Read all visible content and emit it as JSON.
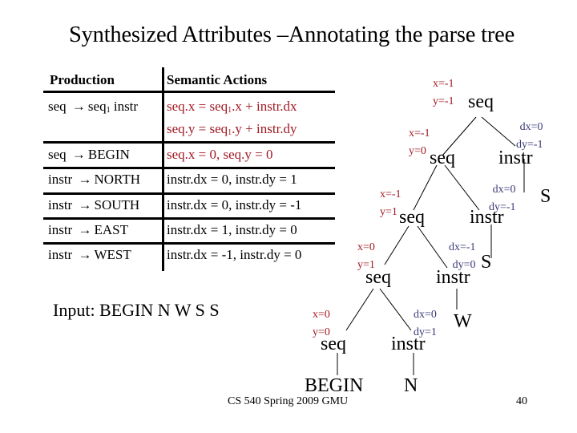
{
  "slide": {
    "title": "Synthesized Attributes –Annotating the parse tree",
    "footer": "CS 540 Spring 2009 GMU",
    "page_number": "40"
  },
  "table": {
    "headers": {
      "production": "Production",
      "actions": "Semantic Actions"
    },
    "rows": [
      {
        "lhs": "seq",
        "arrow": "→",
        "rhs": "seq",
        "rhs_sub": "1",
        "rhs_rest": " instr",
        "actions": [
          {
            "a": "seq.x = seq",
            "sub": "1",
            "b": ".x + instr.dx"
          },
          {
            "a": "seq.y = seq",
            "sub": "1",
            "b": ".y + instr.dy"
          }
        ],
        "action_color": "red"
      },
      {
        "lhs": "seq",
        "arrow": "→",
        "rhs": "BEGIN",
        "actions": [
          "seq.x = 0,  seq.y = 0"
        ],
        "action_color": "red"
      },
      {
        "lhs": "instr",
        "arrow": "→",
        "rhs": "NORTH",
        "actions": [
          "instr.dx = 0, instr.dy = 1"
        ],
        "action_color": "black"
      },
      {
        "lhs": "instr",
        "arrow": "→",
        "rhs": "SOUTH",
        "actions": [
          "instr.dx = 0, instr.dy = -1"
        ],
        "action_color": "black"
      },
      {
        "lhs": "instr",
        "arrow": "→",
        "rhs": "EAST",
        "actions": [
          "instr.dx = 1, instr.dy = 0"
        ],
        "action_color": "black"
      },
      {
        "lhs": "instr",
        "arrow": "→",
        "rhs": "WEST",
        "actions": [
          "instr.dx = -1, instr.dy = 0"
        ],
        "action_color": "black"
      }
    ]
  },
  "input": "Input:  BEGIN N W S S",
  "tree": {
    "nodes": [
      {
        "id": "seq1",
        "label": "seq",
        "attrs": [
          "x=-1",
          "y=-1"
        ],
        "attr_kind": "inherited-xy"
      },
      {
        "id": "seq2",
        "label": "seq",
        "attrs": [
          "x=-1",
          "y=0"
        ],
        "attr_kind": "inherited-xy"
      },
      {
        "id": "instr1",
        "label": "instr",
        "attrs": [
          "dx=0",
          "dy=-1"
        ],
        "attr_kind": "delta"
      },
      {
        "id": "leafS1",
        "label": "S"
      },
      {
        "id": "seq3",
        "label": "seq",
        "attrs": [
          "x=-1",
          "y=1"
        ],
        "attr_kind": "inherited-xy"
      },
      {
        "id": "instr2",
        "label": "instr",
        "attrs": [
          "dx=0",
          "dy=-1"
        ],
        "attr_kind": "delta"
      },
      {
        "id": "leafS2",
        "label": "S"
      },
      {
        "id": "seq4",
        "label": "seq",
        "attrs": [
          "x=0",
          "y=1"
        ],
        "attr_kind": "inherited-xy"
      },
      {
        "id": "instr3",
        "label": "instr",
        "attrs": [
          "dx=-1",
          "dy=0"
        ],
        "attr_kind": "delta"
      },
      {
        "id": "leafW",
        "label": "W"
      },
      {
        "id": "seq5",
        "label": "seq",
        "attrs": [
          "x=0",
          "y=0"
        ],
        "attr_kind": "inherited-xy"
      },
      {
        "id": "instr4",
        "label": "instr",
        "attrs": [
          "dx=0",
          "dy=1"
        ],
        "attr_kind": "delta"
      },
      {
        "id": "leafBEGIN",
        "label": "BEGIN"
      },
      {
        "id": "leafN",
        "label": "N"
      }
    ],
    "edges": [
      [
        "seq1",
        "seq2"
      ],
      [
        "seq1",
        "instr1"
      ],
      [
        "instr1",
        "leafS1"
      ],
      [
        "seq2",
        "seq3"
      ],
      [
        "seq2",
        "instr2"
      ],
      [
        "instr2",
        "leafS2"
      ],
      [
        "seq3",
        "seq4"
      ],
      [
        "seq3",
        "instr3"
      ],
      [
        "instr3",
        "leafW"
      ],
      [
        "seq4",
        "seq5"
      ],
      [
        "seq4",
        "instr4"
      ],
      [
        "seq5",
        "leafBEGIN"
      ],
      [
        "instr4",
        "leafN"
      ]
    ],
    "colors": {
      "xy_attr": "#a11a24",
      "delta_attr": "#3b3b78"
    }
  }
}
